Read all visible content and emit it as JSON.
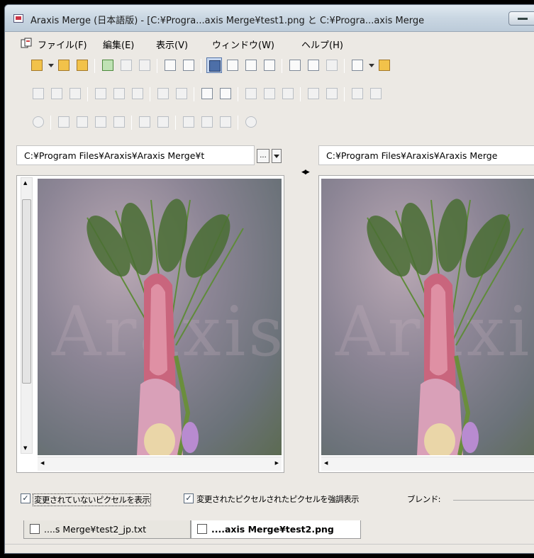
{
  "window": {
    "title": "Araxis Merge (日本語版) - [C:¥Progra...axis Merge¥test1.png と C:¥Progra...axis Merge"
  },
  "menu": {
    "items": [
      "ファイル(F)",
      "編集(E)",
      "表示(V)",
      "ウィンドウ(W)",
      "ヘルプ(H)"
    ]
  },
  "left": {
    "path": "C:¥Program Files¥Araxis¥Araxis Merge¥t",
    "browse_label": "..."
  },
  "right": {
    "path": "C:¥Program Files¥Araxis¥Araxis Merge"
  },
  "image": {
    "watermark": "Araxis"
  },
  "options": {
    "show_unchanged_label": "変更されていないピクセルを表示",
    "show_unchanged_checked": true,
    "highlight_changed_label": "変更されたピクセルされたピクセルを強調表示",
    "highlight_changed_checked": true,
    "blend_label": "ブレンド:"
  },
  "tabs": [
    {
      "label": "....s Merge¥test2_jp.txt",
      "active": false
    },
    {
      "label": "....axis Merge¥test2.png",
      "active": true
    }
  ],
  "icons": {
    "check": "✓",
    "swap": "◀▶",
    "scroll_up": "▲",
    "scroll_down": "▼",
    "scroll_left": "◀",
    "scroll_right": "▶"
  }
}
